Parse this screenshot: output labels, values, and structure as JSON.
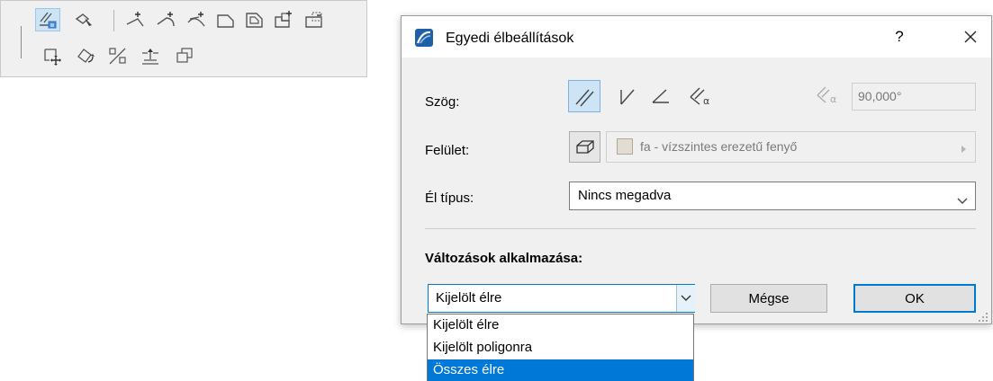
{
  "toolbar": {
    "row1_icons": [
      "edge-settings-icon",
      "pick-up-icon",
      "add-vertex-icon",
      "add-curve-vertex-icon",
      "arc-edit-icon",
      "chamfer-icon",
      "offset-polygon-icon",
      "add-polygon-icon",
      "subtract-polygon-icon"
    ],
    "row2_icons": [
      "move-vertex-icon",
      "rotate-polygon-icon",
      "mirror-icon",
      "elevate-icon",
      "copy-polygon-icon"
    ]
  },
  "dialog": {
    "title": "Egyedi élbeállítások",
    "help": "?",
    "angle": {
      "label": "Szög:",
      "value": "90,000°",
      "options": [
        "perpendicular-icon",
        "vertical-icon",
        "horizontal-icon",
        "custom-angle-icon"
      ]
    },
    "surface": {
      "label": "Felület:",
      "value": "fa - vízszintes erezetű fenyő",
      "swatch_color": "#e3dcd2"
    },
    "edge_type": {
      "label": "Él típus:",
      "value": "Nincs megadva"
    },
    "apply": {
      "label": "Változások alkalmazása:",
      "selected": "Kijelölt élre",
      "options": [
        "Kijelölt élre",
        "Kijelölt poligonra",
        "Összes élre"
      ],
      "highlighted_index": 2
    },
    "buttons": {
      "cancel": "Mégse",
      "ok": "OK"
    },
    "accent_color": "#0078d7"
  }
}
